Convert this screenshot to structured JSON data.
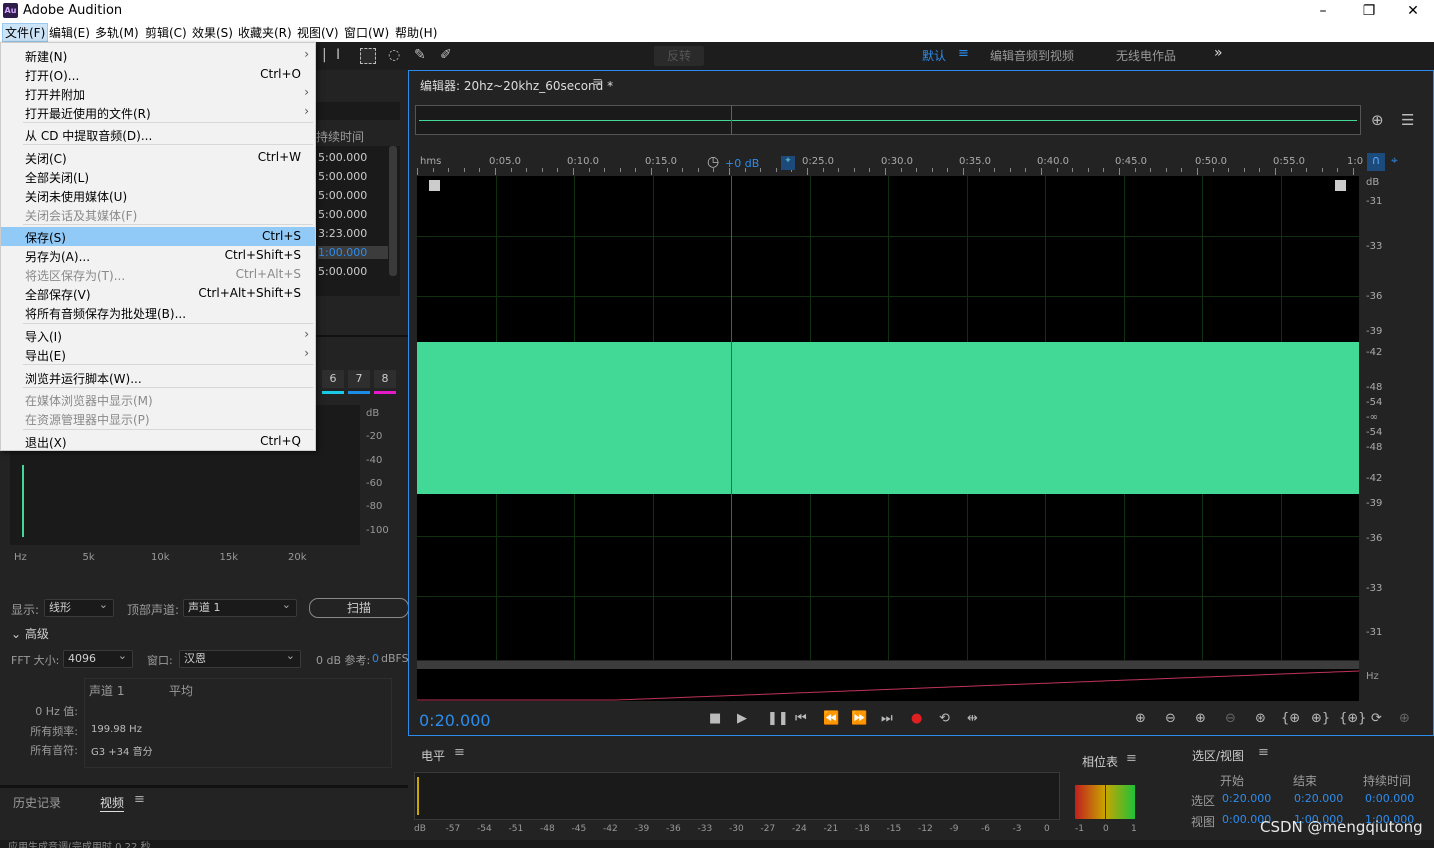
{
  "app": {
    "logo": "Au",
    "title": "Adobe Audition"
  },
  "window": {
    "minimize": "–",
    "restore": "❐",
    "close": "✕"
  },
  "menubar": [
    "文件(F)",
    "编辑(E)",
    "多轨(M)",
    "剪辑(C)",
    "效果(S)",
    "收藏夹(R)",
    "视图(V)",
    "窗口(W)",
    "帮助(H)"
  ],
  "file_menu": [
    {
      "label": "新建(N)",
      "shortcut": "",
      "arrow": true,
      "disabled": false
    },
    {
      "label": "打开(O)...",
      "shortcut": "Ctrl+O",
      "arrow": false,
      "disabled": false
    },
    {
      "label": "打开并附加",
      "shortcut": "",
      "arrow": true,
      "disabled": false
    },
    {
      "label": "打开最近使用的文件(R)",
      "shortcut": "",
      "arrow": true,
      "disabled": false
    },
    {
      "label": "从 CD 中提取音频(D)...",
      "shortcut": "",
      "arrow": false,
      "disabled": false
    },
    {
      "label": "关闭(C)",
      "shortcut": "Ctrl+W",
      "arrow": false,
      "disabled": false
    },
    {
      "label": "全部关闭(L)",
      "shortcut": "",
      "arrow": false,
      "disabled": false
    },
    {
      "label": "关闭未使用媒体(U)",
      "shortcut": "",
      "arrow": false,
      "disabled": false
    },
    {
      "label": "关闭会话及其媒体(F)",
      "shortcut": "",
      "arrow": false,
      "disabled": true
    },
    {
      "label": "保存(S)",
      "shortcut": "Ctrl+S",
      "arrow": false,
      "disabled": false,
      "selected": true
    },
    {
      "label": "另存为(A)...",
      "shortcut": "Ctrl+Shift+S",
      "arrow": false,
      "disabled": false
    },
    {
      "label": "将选区保存为(T)...",
      "shortcut": "Ctrl+Alt+S",
      "arrow": false,
      "disabled": true
    },
    {
      "label": "全部保存(V)",
      "shortcut": "Ctrl+Alt+Shift+S",
      "arrow": false,
      "disabled": false
    },
    {
      "label": "将所有音频保存为批处理(B)...",
      "shortcut": "",
      "arrow": false,
      "disabled": false
    },
    {
      "label": "导入(I)",
      "shortcut": "",
      "arrow": true,
      "disabled": false
    },
    {
      "label": "导出(E)",
      "shortcut": "",
      "arrow": true,
      "disabled": false
    },
    {
      "label": "浏览并运行脚本(W)...",
      "shortcut": "",
      "arrow": false,
      "disabled": false
    },
    {
      "label": "在媒体浏览器中显示(M)",
      "shortcut": "",
      "arrow": false,
      "disabled": true
    },
    {
      "label": "在资源管理器中显示(P)",
      "shortcut": "",
      "arrow": false,
      "disabled": true
    },
    {
      "label": "退出(X)",
      "shortcut": "Ctrl+Q",
      "arrow": false,
      "disabled": false
    }
  ],
  "toolbar": {
    "reverse": "反转",
    "workspaces": [
      "默认",
      "编辑音频到视频",
      "无线电作品"
    ],
    "more": "»"
  },
  "files_panel": {
    "duration_header": "持续时间",
    "durations": [
      "5:00.000",
      "5:00.000",
      "5:00.000",
      "5:00.000",
      "3:23.000",
      "1:00.000",
      "5:00.000"
    ],
    "selected_index": 5
  },
  "channels": {
    "labels": [
      "6",
      "7",
      "8"
    ],
    "colors": [
      "#19c9e6",
      "#1c8de6",
      "#e619c9"
    ]
  },
  "frequency": {
    "db_ticks": [
      "dB",
      "-20",
      "-40",
      "-60",
      "-80",
      "-100"
    ],
    "hz_ticks": [
      "Hz",
      "5k",
      "10k",
      "15k",
      "20k"
    ],
    "display_label": "显示:",
    "display_value": "线形",
    "channel_label": "顶部声道:",
    "channel_value": "声道 1",
    "scan_button": "扫描",
    "advanced": "高级",
    "fft_label": "FFT 大小:",
    "fft_value": "4096",
    "window_label": "窗口:",
    "window_value": "汉恩",
    "ref_label": "0 dB 参考:",
    "ref_value": "0",
    "ref_unit": "dBFS",
    "table_headers": [
      "声道 1",
      "平均"
    ],
    "rows": [
      {
        "label": "0 Hz 值:",
        "value": ""
      },
      {
        "label": "所有频率:",
        "value": "199.98 Hz"
      },
      {
        "label": "所有音符:",
        "value": "G3 +34 音分"
      }
    ]
  },
  "history_tabs": [
    "历史记录",
    "视频"
  ],
  "status": "应用生成音调(完成用时 0.22 秒",
  "editor": {
    "title": "编辑器: 20hz~20khz_60second *",
    "current_time": "0:20.000",
    "ruler": [
      "hms",
      "0:05.0",
      "0:10.0",
      "0:15.0",
      "0:25.0",
      "0:30.0",
      "0:35.0",
      "0:40.0",
      "0:45.0",
      "0:50.0",
      "0:55.0",
      "1:0"
    ],
    "gain": "+0 dB",
    "db_scale": [
      "dB",
      "-31",
      "-33",
      "-36",
      "-39",
      "-42",
      "-48",
      "-54",
      "-∞",
      "-54",
      "-48",
      "-42",
      "-39",
      "-36",
      "-33",
      "-31"
    ],
    "hz_label": "Hz",
    "waveform_color": "#41d995",
    "playhead_fraction": 0.333
  },
  "level_panel": {
    "title": "电平",
    "scale": [
      "dB",
      "-57",
      "-54",
      "-51",
      "-48",
      "-45",
      "-42",
      "-39",
      "-36",
      "-33",
      "-30",
      "-27",
      "-24",
      "-21",
      "-18",
      "-15",
      "-12",
      "-9",
      "-6",
      "-3",
      "0"
    ]
  },
  "phase_panel": {
    "title": "相位表",
    "scale": [
      "-1",
      "0",
      "1"
    ]
  },
  "selection_panel": {
    "title": "选区/视图",
    "headers": [
      "开始",
      "结束",
      "持续时间"
    ],
    "rows": [
      {
        "label": "选区",
        "start": "0:20.000",
        "end": "0:20.000",
        "duration": "0:00.000"
      },
      {
        "label": "视图",
        "start": "0:00.000",
        "end": "1:00.000",
        "duration": "1:00.000"
      }
    ]
  },
  "watermark": "CSDN @mengqiutong"
}
